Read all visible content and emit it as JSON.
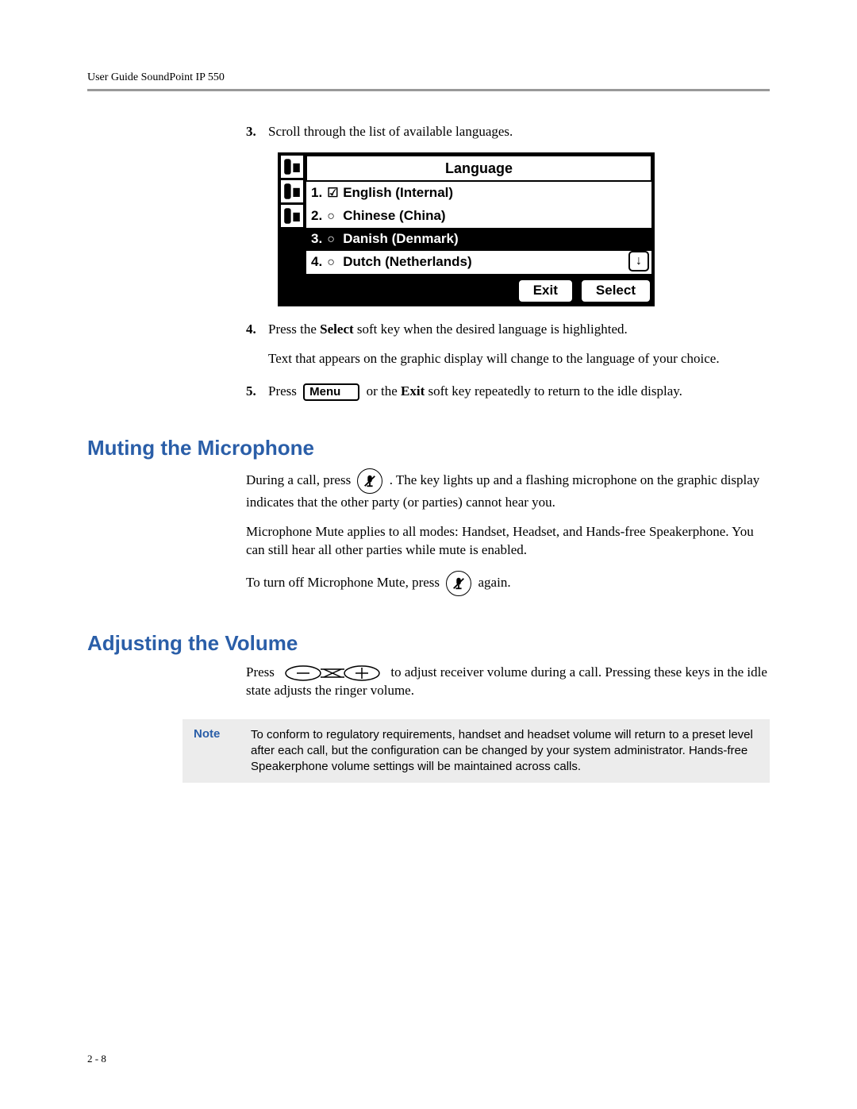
{
  "header": "User Guide SoundPoint IP 550",
  "steps": {
    "s3": {
      "num": "3.",
      "text": "Scroll through the list of available languages."
    },
    "s4": {
      "num": "4.",
      "text_a": "Press the ",
      "bold1": "Select",
      "text_b": " soft key when the desired language is highlighted.",
      "sub": "Text that appears on the graphic display will change to the language of your choice."
    },
    "s5": {
      "num": "5.",
      "text_a": "Press ",
      "menu_label": "Menu",
      "text_b": " or the ",
      "bold1": "Exit",
      "text_c": " soft key repeatedly to return to the idle display."
    }
  },
  "lcd": {
    "title": "Language",
    "items": [
      {
        "num": "1.",
        "text": "English (Internal)",
        "checked": true,
        "selected": false
      },
      {
        "num": "2.",
        "text": "Chinese (China)",
        "checked": false,
        "selected": false
      },
      {
        "num": "3.",
        "text": "Danish (Denmark)",
        "checked": false,
        "selected": true
      },
      {
        "num": "4.",
        "text": "Dutch (Netherlands)",
        "checked": false,
        "selected": false
      }
    ],
    "softkeys": {
      "exit": "Exit",
      "select": "Select"
    },
    "scroll_glyph": "↓"
  },
  "section_mute": {
    "heading": "Muting the Microphone",
    "p1_a": "During a call, press ",
    "p1_b": ". The key lights up and a flashing microphone on the graphic display indicates that the other party (or parties) cannot hear you.",
    "p2": "Microphone Mute applies to all modes: Handset, Headset, and Hands-free Speakerphone. You can still hear all other parties while mute is enabled.",
    "p3_a": "To turn off Microphone Mute, press ",
    "p3_b": " again."
  },
  "section_vol": {
    "heading": "Adjusting the Volume",
    "p1_a": "Press ",
    "p1_b": " to adjust receiver volume during a call. Pressing these keys in the idle state adjusts the ringer volume."
  },
  "note": {
    "label": "Note",
    "text": "To conform to regulatory requirements, handset and headset volume will return to a preset level after each call, but the configuration can be changed by your system administrator. Hands-free Speakerphone volume settings will be maintained across calls."
  },
  "page_number": "2 - 8"
}
